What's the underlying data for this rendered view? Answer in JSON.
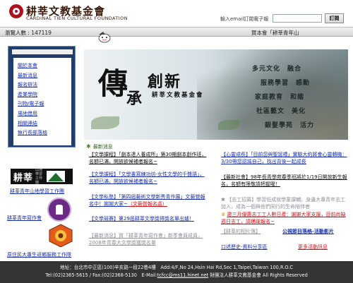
{
  "header": {
    "org_name": "耕莘文教基金會",
    "org_name_en": "CARDINAL TIEN CULTURAL FOUNDATION",
    "subscribe_label": "輸入email訂閱電子報",
    "subscribe_placeholder": "",
    "subscribe_button": "訂閱"
  },
  "infobar": {
    "visitor_count": "瀏覽人數 : 147119",
    "greeting": "賀本會「耕莘青年山"
  },
  "sidebar": {
    "menu_items": [
      {
        "label": "關於本會"
      },
      {
        "label": "最新消息"
      },
      {
        "label": "報名辦法"
      },
      {
        "label": "產業學院"
      },
      {
        "label": "刊物/電子報"
      },
      {
        "label": "場地借用"
      },
      {
        "label": "相關連結"
      },
      {
        "label": "執行長部落格"
      }
    ],
    "partners": [
      {
        "name": "耕莘青年山地學習工作團",
        "logo_text": "耕莘",
        "logo_sub": "山地學習工作團"
      },
      {
        "name": "耕莘青年寫作會"
      },
      {
        "name": "原住民大專生返鄉服務工作隊"
      }
    ]
  },
  "banner": {
    "char_big": "傳",
    "char_small": "承",
    "word": "創新",
    "subtitle": "耕莘文教基金會",
    "slogans": [
      "多元文化　融合",
      "服務學習　感動",
      "家庭教育　和諧",
      "社區藝文　美化",
      "銀髮學苑　活力"
    ]
  },
  "news": {
    "title": "最新消息",
    "left": [
      {
        "text": "【文學課程】「劇本達人養成所」第30期劇本創作班，名額已滿，開放欲候補者報名~",
        "style": "black-link"
      },
      {
        "text": "【文學課程】「文學書寫練功坊-女性文學的千聲語」，名額已滿，開放欲候補者報名~",
        "style": "link"
      },
      {
        "text": "【文學私塾】「第四屆藝術文學新秀青作展」文藝營報名中！謝謝大家~",
        "extra": "（文藝營報名處）",
        "style": "link"
      },
      {
        "text": "【文學競賽】第29屆耕莘文學獎得獎名單出爐！",
        "style": "link"
      },
      {
        "text": "【最新消息】賀「耕莘青年寫作會」新季會員成員，2008年青春大文學獎獲獎名單",
        "style": "gray"
      }
    ],
    "right": [
      {
        "text": "【心靈成長】「目前您與聖誕禮」實驗大約將會心靈轉機：3/30帶您認識自己，找出背後一起成長",
        "style": "link"
      },
      {
        "text": "【最新社會】98年長青學苑春季班將於1/19日開放新生報名，名額有限敬請把握喔！",
        "style": "black-link"
      },
      {
        "text": "【志工招募】學習低成就學童課輔，身邊大專青年志工加入，成為一個與他們同行的生命陪伴者",
        "style": "gray"
      },
      {
        "text": "邀三月優惠志工工人數日產：謝謝大家支援，目前尚缺週日志工，請踴躍報名~",
        "style": "red"
      },
      {
        "text": "【耕莘的相片簿】",
        "style": "grayu"
      },
      {
        "text": "公視節目落格-活動影片",
        "style": "link"
      },
      {
        "text": "口述歷史-資料分享區",
        "style": "link"
      },
      {
        "text": "更多活動訊息",
        "style": "red"
      }
    ]
  },
  "footer": {
    "line1": "地址：台北市中正區(100)辛亥路一段22巷4樓　Add:4/F,No 24,Hsin Hai Rd,Sec 1,Taipei,Taiwan 100,R.O.C",
    "line2_prefix": "Tel:(02)2365-5615 / Fax:(02)2368-5130　E-Mail:",
    "email": "tcfcc@ms11.hinet.net",
    "line2_suffix": " 財團法人耕莘文教基金會 All Rights Reserved"
  },
  "colors": {
    "brand_red": "#b0101c",
    "menu_blue": "#1f3d6d",
    "link_blue": "#1a2fa8",
    "alert_red": "#d0141b",
    "footer_bg": "#343434"
  }
}
